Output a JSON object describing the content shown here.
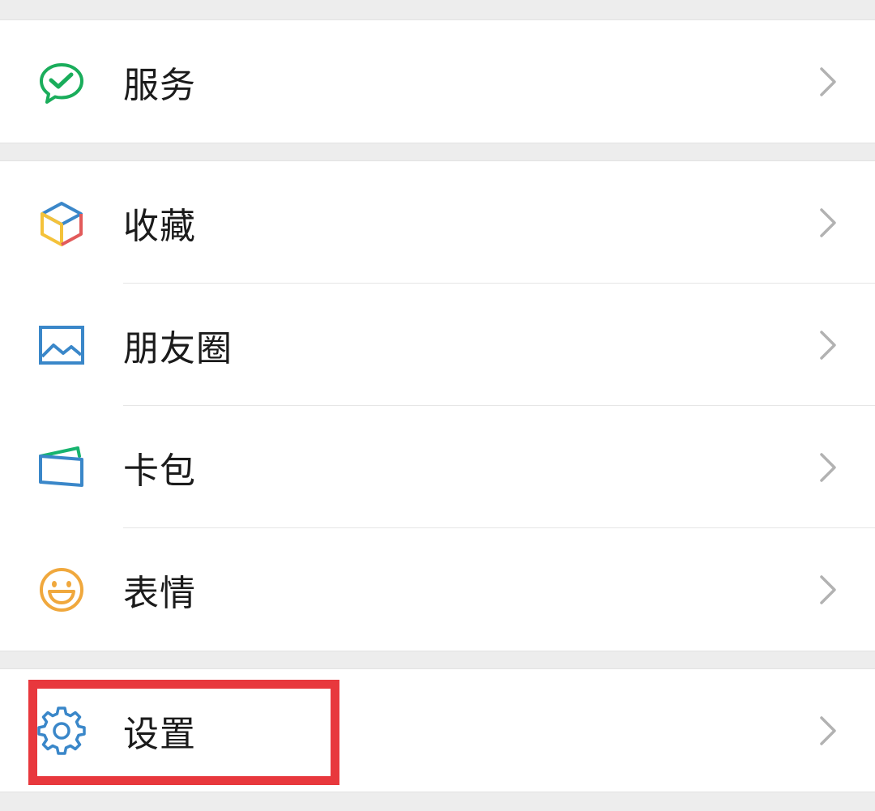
{
  "menu": {
    "groups": [
      {
        "items": [
          {
            "label": "服务",
            "icon": "services-icon"
          }
        ]
      },
      {
        "items": [
          {
            "label": "收藏",
            "icon": "favorites-cube-icon"
          },
          {
            "label": "朋友圈",
            "icon": "moments-picture-icon"
          },
          {
            "label": "卡包",
            "icon": "card-wallet-icon"
          },
          {
            "label": "表情",
            "icon": "sticker-smiley-icon"
          }
        ]
      },
      {
        "items": [
          {
            "label": "设置",
            "icon": "settings-gear-icon"
          }
        ]
      }
    ]
  },
  "colors": {
    "background": "#ededed",
    "surface": "#ffffff",
    "text": "#1b1b1b",
    "chevron": "#b2b2b2",
    "services_green": "#1aad5b",
    "icon_blue": "#3a87c9",
    "icon_yellow": "#f4c23a",
    "icon_red": "#e25a5a",
    "card_green": "#17b46f",
    "smiley_orange": "#f0a83d",
    "highlight_red": "#e8383d"
  }
}
